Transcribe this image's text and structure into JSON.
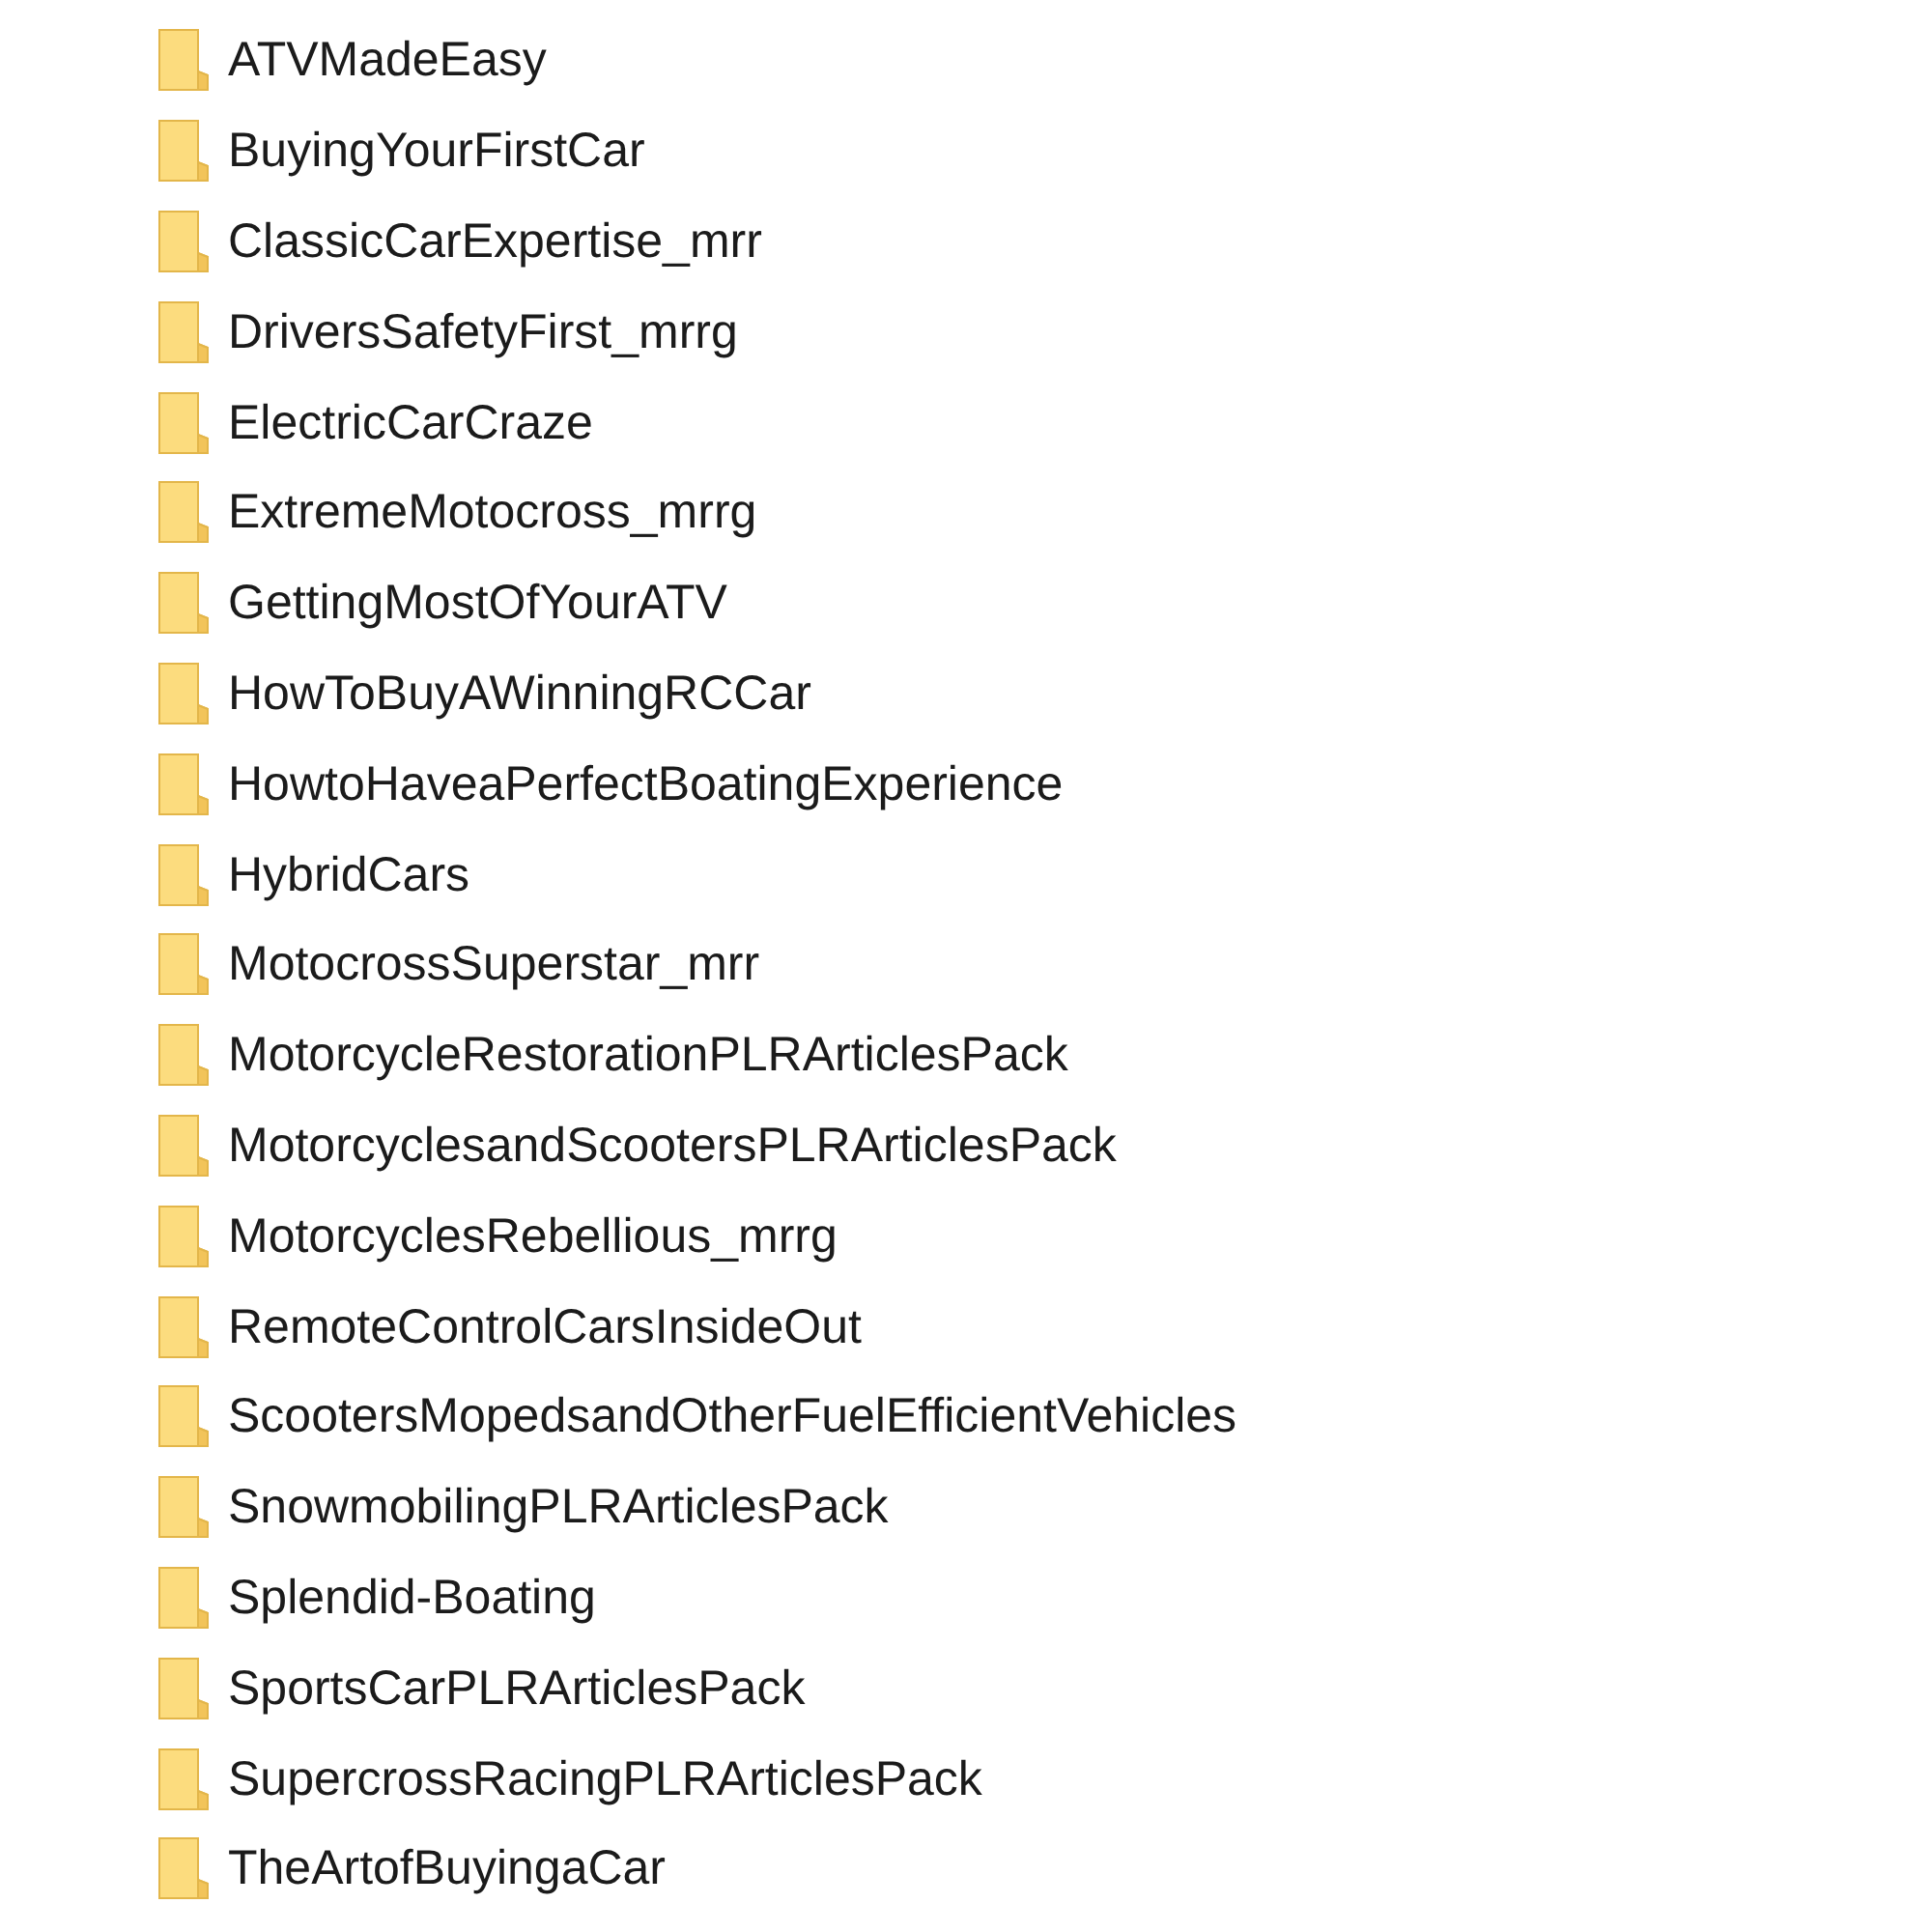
{
  "folders": [
    {
      "name": "ATVMadeEasy"
    },
    {
      "name": "BuyingYourFirstCar"
    },
    {
      "name": "ClassicCarExpertise_mrr"
    },
    {
      "name": "DriversSafetyFirst_mrrg"
    },
    {
      "name": "ElectricCarCraze"
    },
    {
      "name": "ExtremeMotocross_mrrg"
    },
    {
      "name": "GettingMostOfYourATV"
    },
    {
      "name": "HowToBuyAWinningRCCar"
    },
    {
      "name": "HowtoHaveaPerfectBoatingExperience"
    },
    {
      "name": "HybridCars"
    },
    {
      "name": "MotocrossSuperstar_mrr"
    },
    {
      "name": "MotorcycleRestorationPLRArticlesPack"
    },
    {
      "name": "MotorcyclesandScootersPLRArticlesPack"
    },
    {
      "name": "MotorcyclesRebellious_mrrg"
    },
    {
      "name": "RemoteControlCarsInsideOut"
    },
    {
      "name": "ScootersMopedsandOtherFuelEfficientVehicles"
    },
    {
      "name": "SnowmobilingPLRArticlesPack"
    },
    {
      "name": "Splendid-Boating"
    },
    {
      "name": "SportsCarPLRArticlesPack"
    },
    {
      "name": "SupercrossRacingPLRArticlesPack"
    },
    {
      "name": "TheArtofBuyingaCar"
    }
  ]
}
